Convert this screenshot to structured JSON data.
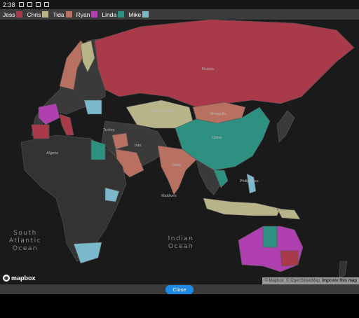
{
  "status_bar": {
    "time": "2:38"
  },
  "legend": [
    {
      "name": "Jess",
      "color": "#a83a4a"
    },
    {
      "name": "Chris",
      "color": "#b8b48a"
    },
    {
      "name": "Tida",
      "color": "#b87060"
    },
    {
      "name": "Ryan",
      "color": "#b040b0"
    },
    {
      "name": "Linda",
      "color": "#2e9080"
    },
    {
      "name": "Mike",
      "color": "#7ab8cc"
    }
  ],
  "map": {
    "labels": {
      "south_atlantic": "South\nAtlantic\nOcean",
      "indian_ocean": "Indian\nOcean",
      "russia": "Russia",
      "kazakhstan": "Kazakhstan",
      "mongolia": "Mongolia",
      "china": "China",
      "india": "India",
      "iran": "Iran",
      "turkey": "Turkey",
      "algeria": "Algeria",
      "philippines": "Philippines",
      "maldives": "Maldives"
    },
    "brand": "mapbox",
    "attribution": {
      "copy1": "© Mapbox",
      "copy2": "© OpenStreetMap",
      "improve": "Improve this map"
    }
  },
  "actions": {
    "close_label": "Close"
  }
}
